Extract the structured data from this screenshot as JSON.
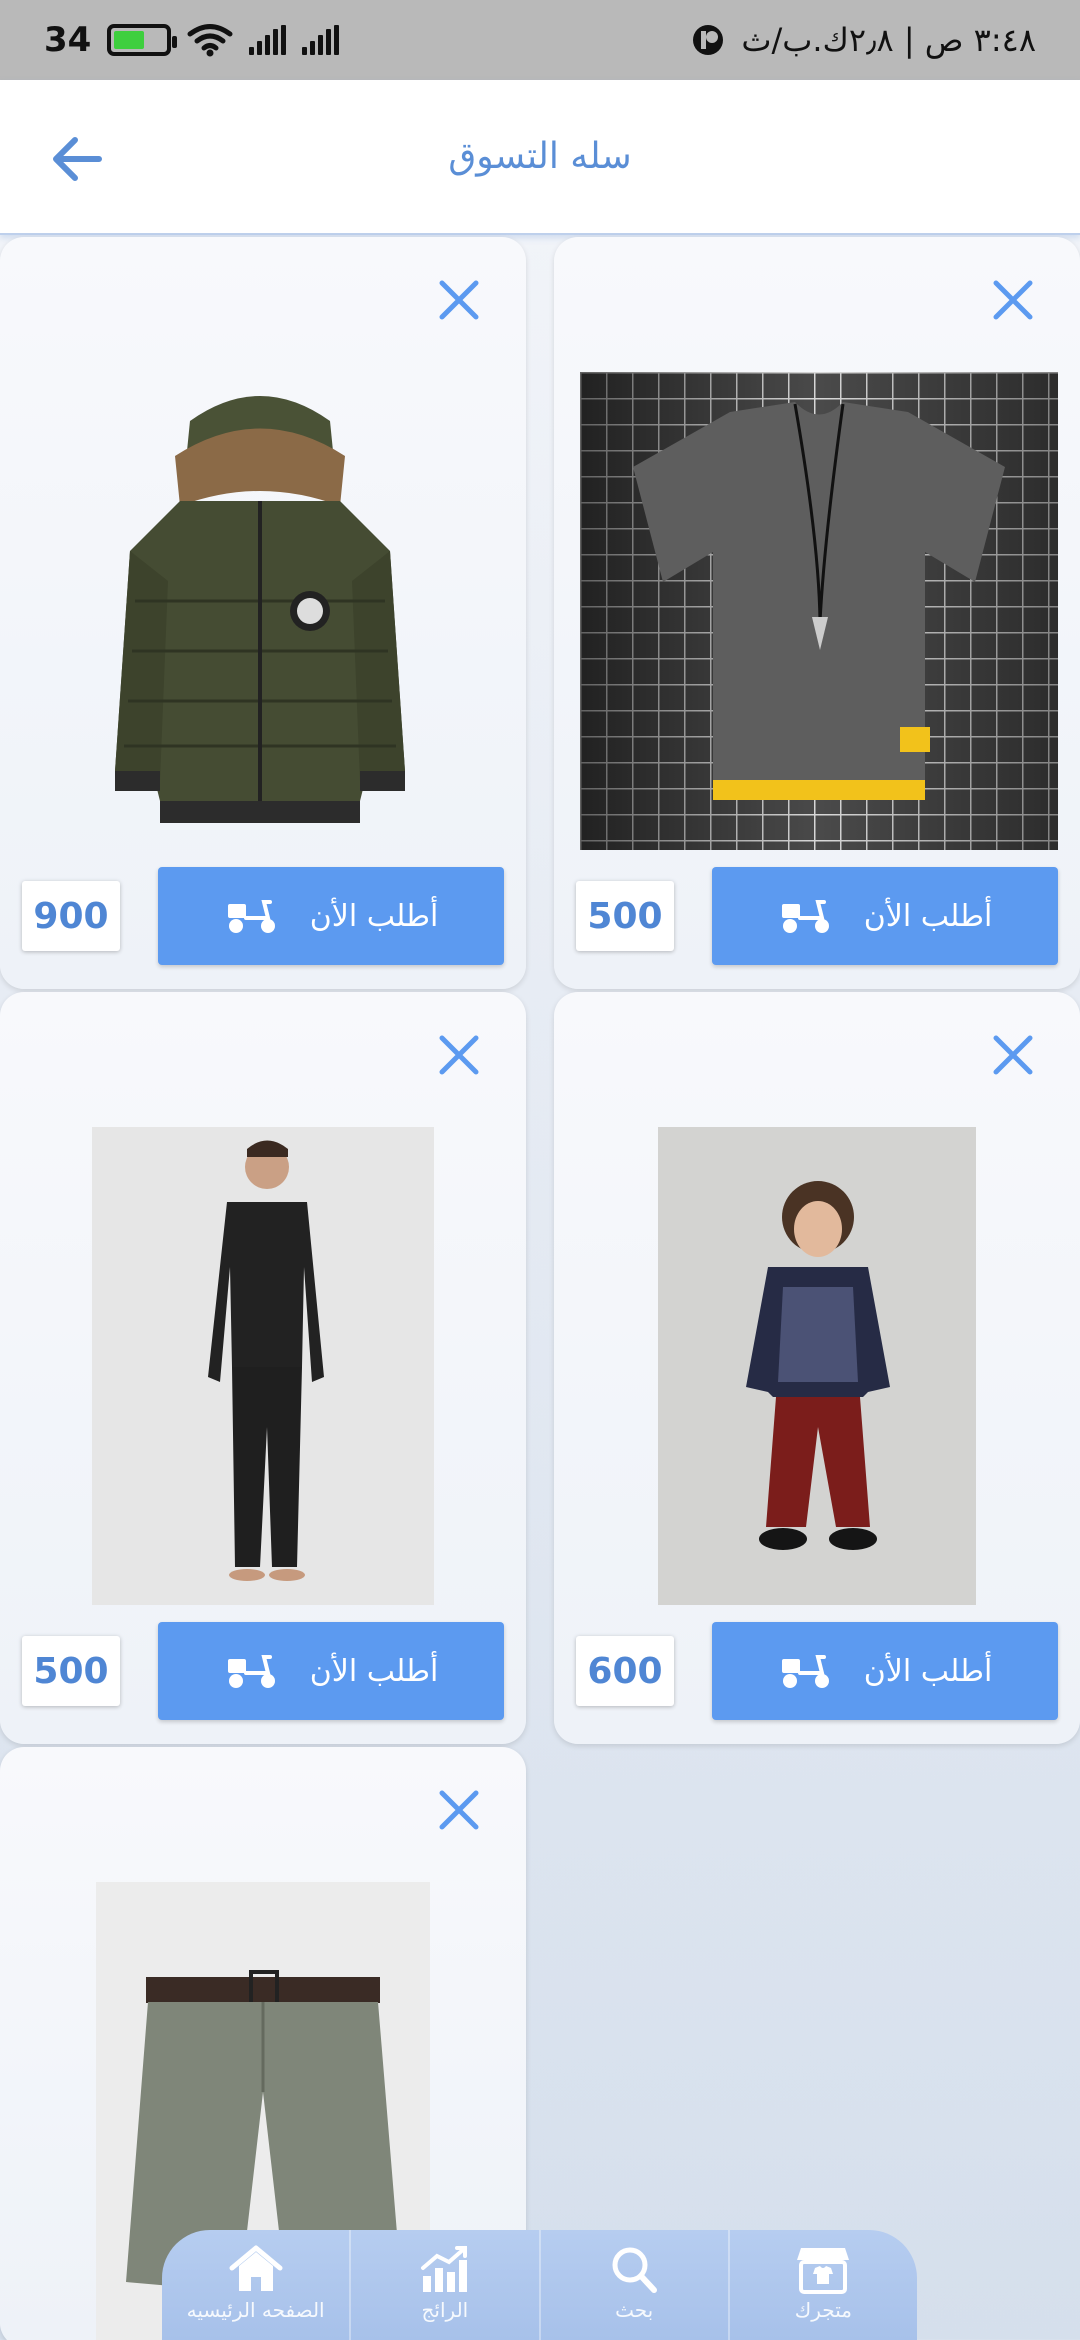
{
  "status_bar": {
    "battery": "34",
    "time_info": "٣:٤٨ ص | ٢٫٨ك.ب/ث"
  },
  "header": {
    "title": "سله التسوق"
  },
  "cart_items": [
    {
      "order_label": "أطلب الأن",
      "price": "500",
      "product": "grey t-shirt"
    },
    {
      "order_label": "أطلب الأن",
      "price": "900",
      "product": "green puffer jacket"
    },
    {
      "order_label": "أطلب الأن",
      "price": "600",
      "product": "kids sweater and pants"
    },
    {
      "order_label": "أطلب الأن",
      "price": "500",
      "product": "black pajama set"
    },
    {
      "product": "grey shorts"
    }
  ],
  "bottom_nav": {
    "items": [
      {
        "label": "متجرك",
        "icon": "store-icon"
      },
      {
        "label": "بحث",
        "icon": "search-icon"
      },
      {
        "label": "الرائج",
        "icon": "trending-chart-icon"
      },
      {
        "label": "الصفحه الرئيسيه",
        "icon": "home-icon"
      }
    ]
  },
  "colors": {
    "accent": "#5c9af0",
    "title": "#5a8ed6",
    "status_bar": "#b9b9b9"
  }
}
